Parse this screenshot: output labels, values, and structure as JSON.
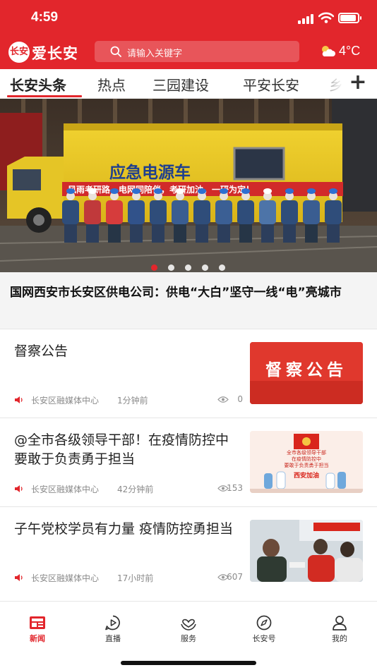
{
  "status_bar": {
    "time": "4:59"
  },
  "header": {
    "logo_mark": "长安",
    "app_name": "爱长安",
    "search_placeholder": "请输入关键字",
    "temperature": "4°C",
    "weather_icon": "partly-cloudy-icon",
    "accent_color": "#e2262c"
  },
  "tabs": [
    "长安头条",
    "热点",
    "三园建设",
    "平安长安",
    "乡"
  ],
  "tabs_active_index": 0,
  "banner": {
    "truck_title": "应急电源车",
    "truck_slogan": "风雨考研路，电网同陪伴，考研加油，一研为定！",
    "carousel_count": 5,
    "carousel_active_index": 0,
    "headline": "国网西安市长安区供电公司：供电“大白”坚守一线“电”亮城市"
  },
  "news": [
    {
      "title": "督察公告",
      "source": "长安区融媒体中心",
      "time_ago": "1分钟前",
      "views": "0",
      "thumb_text": "督察公告"
    },
    {
      "title": "@全市各级领导干部！在疫情防控中要敢于负责勇于担当",
      "source": "长安区融媒体中心",
      "time_ago": "42分钟前",
      "views": "153",
      "thumb_lines": [
        "全市各级领导干部",
        "在疫情防控中",
        "要敢于负责勇于担当"
      ],
      "thumb_caption": "西安加油"
    },
    {
      "title": "子午党校学员有力量 疫情防控勇担当",
      "source": "长安区融媒体中心",
      "time_ago": "17小时前",
      "views": "607"
    }
  ],
  "bottom_nav": [
    {
      "label": "新闻",
      "icon": "news-icon"
    },
    {
      "label": "直播",
      "icon": "live-play-icon"
    },
    {
      "label": "服务",
      "icon": "service-heart-icon"
    },
    {
      "label": "长安号",
      "icon": "compass-icon"
    },
    {
      "label": "我的",
      "icon": "profile-icon"
    }
  ],
  "bottom_nav_active_index": 0
}
